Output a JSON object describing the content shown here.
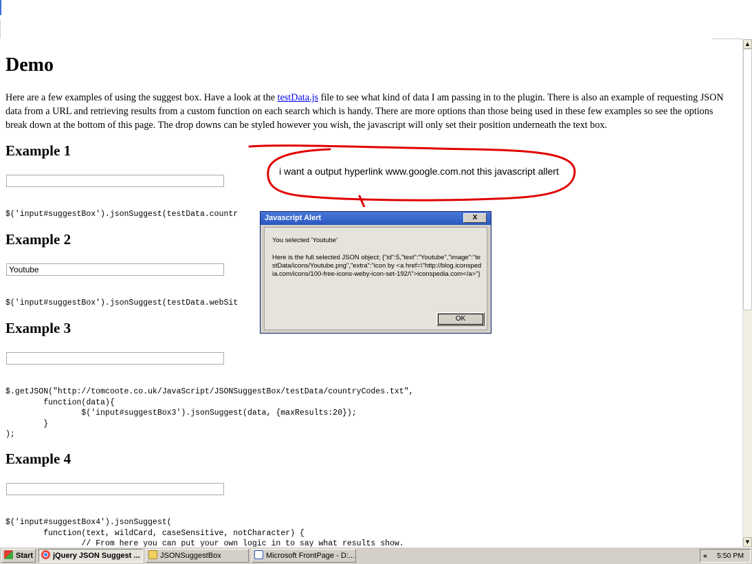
{
  "page": {
    "heading": "Demo",
    "intro_before_link": "Here are a few examples of using the suggest box. Have a look at the ",
    "intro_link": "testData.js",
    "intro_after_link": " file to see what kind of data I am passing in to the plugin. There is also an example of requesting JSON data from a URL and retrieving results from a custom function on each search which is handy. There are more options than those being used in these few examples so see the options break down at the bottom of this page. The drop downs can be styled however you wish, the javascript will only set their position underneath the text box.",
    "examples": [
      {
        "title": "Example 1",
        "input_value": "",
        "code": "$('input#suggestBox').jsonSuggest(testData.countr"
      },
      {
        "title": "Example 2",
        "input_value": "Youtube",
        "code": "$('input#suggestBox').jsonSuggest(testData.webSit"
      },
      {
        "title": "Example 3",
        "input_value": "",
        "code": "$.getJSON(\"http://tomcoote.co.uk/JavaScript/JSONSuggestBox/testData/countryCodes.txt\",\n        function(data){\n                $('input#suggestBox3').jsonSuggest(data, {maxResults:20});\n        }\n);"
      },
      {
        "title": "Example 4",
        "input_value": "",
        "code": "$('input#suggestBox4').jsonSuggest(\n        function(text, wildCard, caseSensitive, notCharacter) {\n                // From here you can put your own logic in to say what results show."
      }
    ]
  },
  "annotation": {
    "text": "i want a output hyperlink www.google.com.not this javascript allert",
    "color": "#e00000"
  },
  "alert": {
    "title": "Javascript Alert",
    "close_label": "X",
    "message_line1": "You selected 'Youtube'",
    "message_line2": "Here is the full selected JSON object; {\"id\":5,\"text\":\"Youtube\",\"image\":\"testData/icons/Youtube.png\",\"extra\":\"icon by <a href=\\\"http://blog.iconspedia.com/icons/100-free-icons-weby-icon-set-192/\\\">iconspedia.com</a>\"}",
    "ok_label": "OK"
  },
  "taskbar": {
    "start_label": "Start",
    "buttons": [
      {
        "label": "jQuery JSON Suggest ...",
        "icon": "chrome-icon",
        "pressed": true
      },
      {
        "label": "JSONSuggestBox",
        "icon": "folder-icon",
        "pressed": false
      },
      {
        "label": "Microsoft FrontPage - D:...",
        "icon": "frontpage-icon",
        "pressed": false
      }
    ],
    "tray_chevron": "«",
    "clock": "5:50 PM"
  }
}
